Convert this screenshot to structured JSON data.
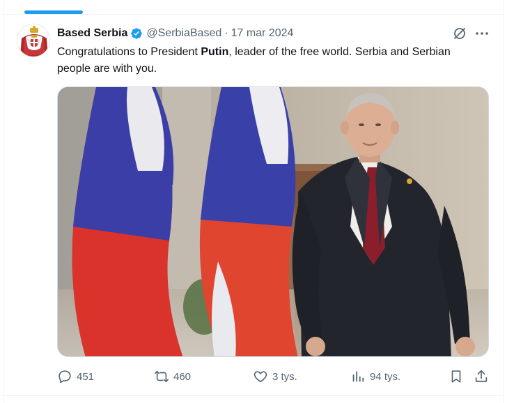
{
  "tweet": {
    "author": {
      "display_name": "Based Serbia",
      "handle": "@SerbiaBased",
      "verified": true,
      "avatar_icon": "serbia-coat-of-arms"
    },
    "separator": "·",
    "date": "17 mar 2024",
    "text_part1": "Congratulations to President ",
    "text_bold": "Putin",
    "text_part2": ", leader of the free world. Serbia and Serbian people are with you.",
    "media_icon": "photo-putin-with-russian-flags",
    "stats": {
      "replies": "451",
      "reposts": "460",
      "likes": "3 tys.",
      "views": "94 tys."
    }
  },
  "colors": {
    "accent": "#1d9bf0",
    "text_primary": "#0f1419",
    "text_secondary": "#536471"
  }
}
